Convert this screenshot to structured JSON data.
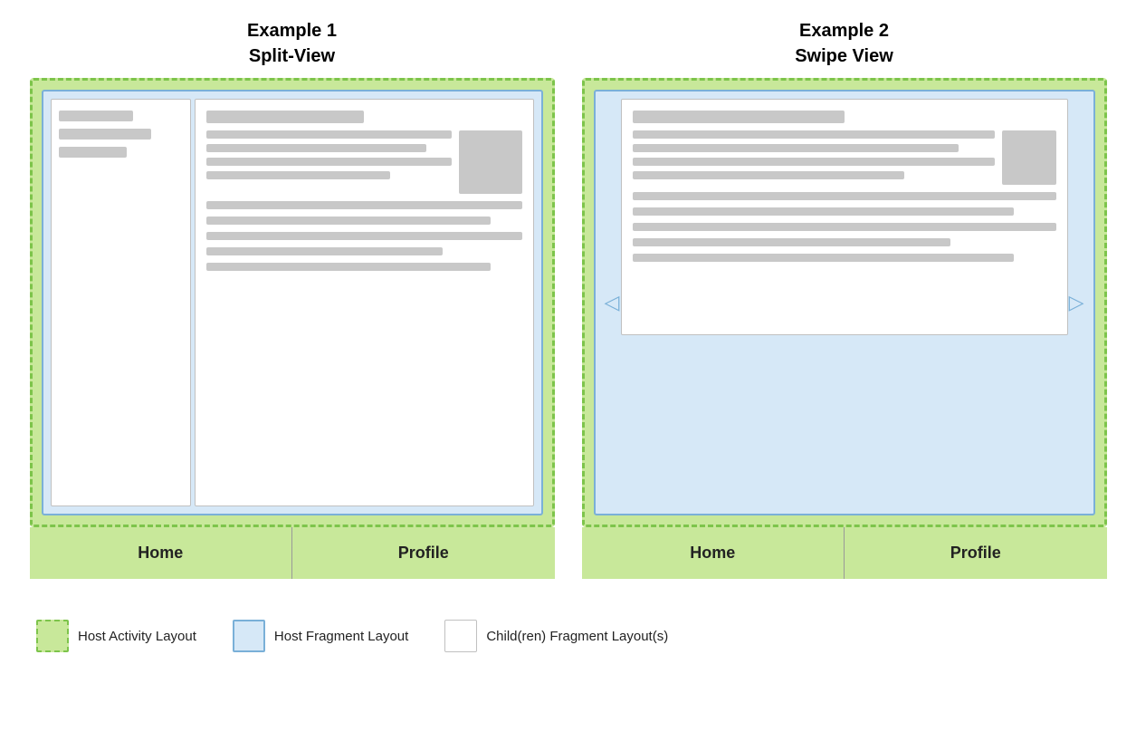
{
  "example1": {
    "title_line1": "Example 1",
    "title_line2": "Split-View",
    "tab_home": "Home",
    "tab_profile": "Profile"
  },
  "example2": {
    "title_line1": "Example 2",
    "title_line2": "Swipe View",
    "tab_home": "Home",
    "tab_profile": "Profile",
    "arrow_left": "◁",
    "arrow_right": "▷"
  },
  "legend": {
    "item1_label": "Host Activity Layout",
    "item2_label": "Host Fragment Layout",
    "item3_label": "Child(ren) Fragment Layout(s)"
  }
}
